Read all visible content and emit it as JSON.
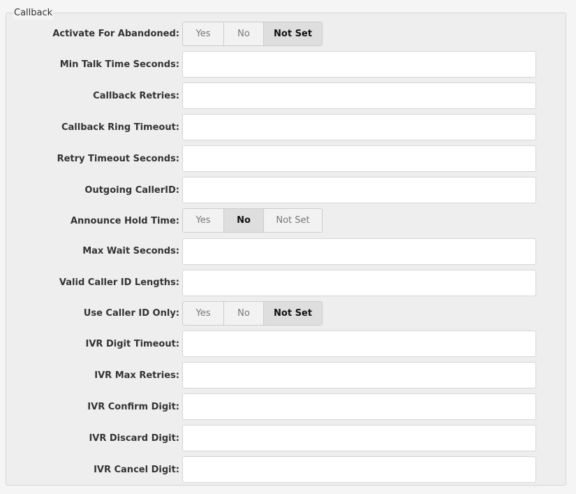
{
  "section": {
    "legend": "Callback"
  },
  "toggle_options": {
    "yes": "Yes",
    "no": "No",
    "not_set": "Not Set"
  },
  "fields": {
    "activate_for_abandoned": {
      "label": "Activate For Abandoned:",
      "selected": "Not Set"
    },
    "min_talk_time_seconds": {
      "label": "Min Talk Time Seconds:",
      "value": ""
    },
    "callback_retries": {
      "label": "Callback Retries:",
      "value": ""
    },
    "callback_ring_timeout": {
      "label": "Callback Ring Timeout:",
      "value": ""
    },
    "retry_timeout_seconds": {
      "label": "Retry Timeout Seconds:",
      "value": ""
    },
    "outgoing_callerid": {
      "label": "Outgoing CallerID:",
      "value": ""
    },
    "announce_hold_time": {
      "label": "Announce Hold Time:",
      "selected": "No"
    },
    "max_wait_seconds": {
      "label": "Max Wait Seconds:",
      "value": ""
    },
    "valid_caller_id_lengths": {
      "label": "Valid Caller ID Lengths:",
      "value": ""
    },
    "use_caller_id_only": {
      "label": "Use Caller ID Only:",
      "selected": "Not Set"
    },
    "ivr_digit_timeout": {
      "label": "IVR Digit Timeout:",
      "value": ""
    },
    "ivr_max_retries": {
      "label": "IVR Max Retries:",
      "value": ""
    },
    "ivr_confirm_digit": {
      "label": "IVR Confirm Digit:",
      "value": ""
    },
    "ivr_discard_digit": {
      "label": "IVR Discard Digit:",
      "value": ""
    },
    "ivr_cancel_digit": {
      "label": "IVR Cancel Digit:",
      "value": ""
    }
  }
}
